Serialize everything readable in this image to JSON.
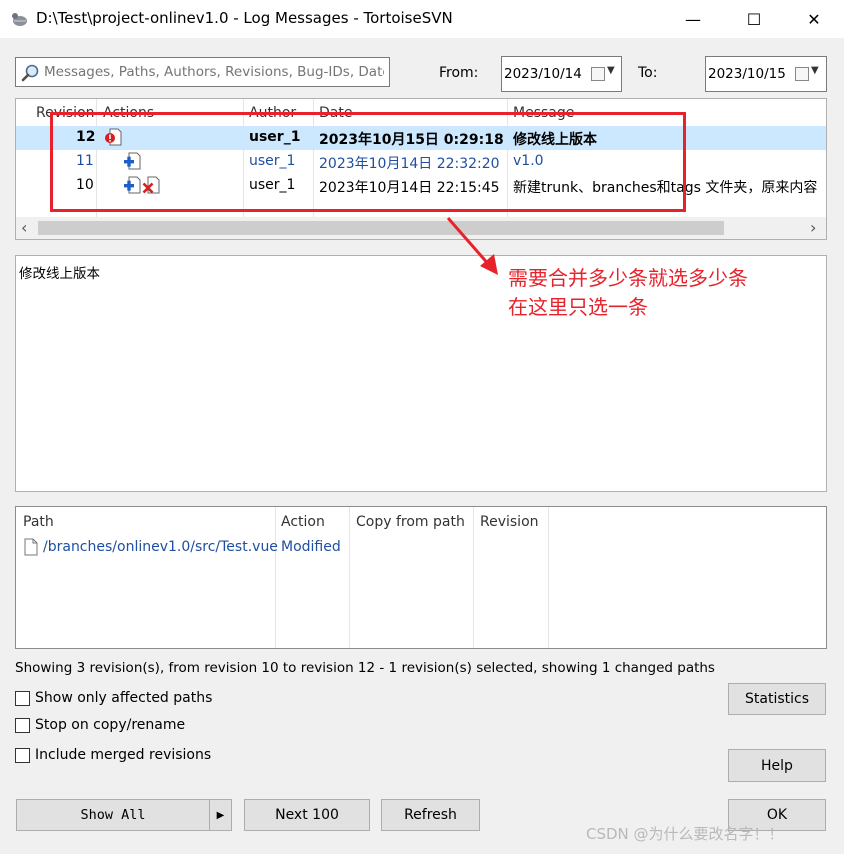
{
  "window": {
    "title": "D:\\Test\\project-onlinev1.0 - Log Messages - TortoiseSVN",
    "minimize": "—",
    "maximize": "☐",
    "close": "✕"
  },
  "filter": {
    "search_placeholder": "Messages, Paths, Authors, Revisions, Bug-IDs, Date, D",
    "from_label": "From:",
    "from_date": "2023/10/14",
    "to_label": "To:",
    "to_date": "2023/10/15"
  },
  "revisions": {
    "headers": [
      "Revision",
      "Actions",
      "Author",
      "Date",
      "Message"
    ],
    "rows": [
      {
        "revision": "12",
        "author": "user_1",
        "date": "2023年10月15日 0:29:18",
        "message": "修改线上版本",
        "selected": true,
        "bold": true,
        "color": "#000000"
      },
      {
        "revision": "11",
        "author": "user_1",
        "date": "2023年10月14日 22:32:20",
        "message": "v1.0",
        "selected": false,
        "bold": false,
        "color": "#1f4fa0"
      },
      {
        "revision": "10",
        "author": "user_1",
        "date": "2023年10月14日 22:15:45",
        "message": "新建trunk、branches和tags 文件夹，原来内容",
        "selected": false,
        "bold": false,
        "color": "#000000"
      }
    ],
    "scroll_left": "‹",
    "scroll_right": "›"
  },
  "message_text": "修改线上版本",
  "paths": {
    "headers": [
      "Path",
      "Action",
      "Copy from path",
      "Revision"
    ],
    "rows": [
      {
        "path": "/branches/onlinev1.0/src/Test.vue",
        "action": "Modified",
        "copy_from": "",
        "revision": ""
      }
    ]
  },
  "status_text": "Showing 3 revision(s), from revision 10 to revision 12 - 1 revision(s) selected, showing 1 changed paths",
  "options": {
    "show_only_affected": "Show only affected paths",
    "stop_on_copy": "Stop on copy/rename",
    "include_merged": "Include merged revisions"
  },
  "buttons": {
    "statistics": "Statistics",
    "help": "Help",
    "show_all": "Show All",
    "show_all_arrow": "▶",
    "next100": "Next 100",
    "refresh": "Refresh",
    "ok": "OK"
  },
  "annotation": {
    "line1": "需要合并多少条就选多少条",
    "line2": "在这里只选一条",
    "color": "#e8222b"
  },
  "watermark": "CSDN @为什么要改名字！！"
}
